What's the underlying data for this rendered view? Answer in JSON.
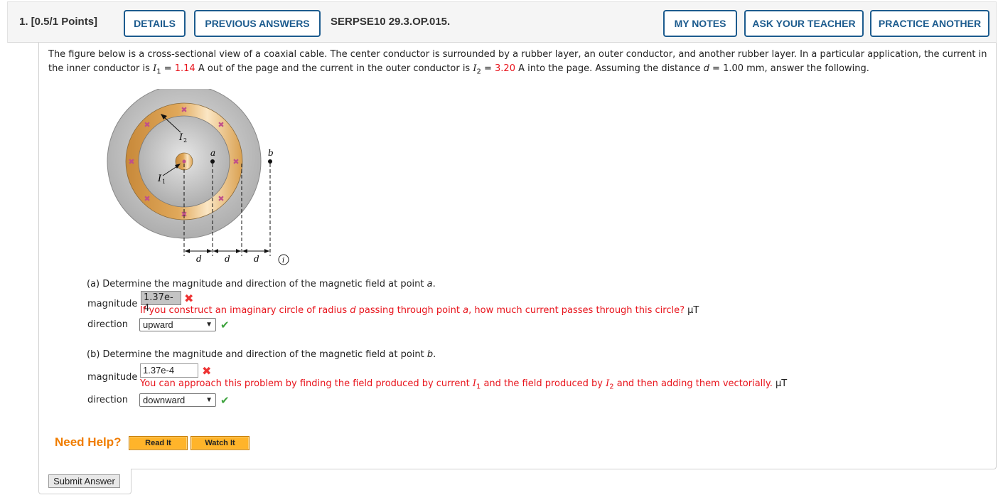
{
  "header": {
    "question_label": "1.  [0.5/1 Points]",
    "details_button": "DETAILS",
    "previous_answers_button": "PREVIOUS ANSWERS",
    "question_id": "SERPSE10 29.3.OP.015.",
    "my_notes_button": "MY NOTES",
    "ask_teacher_button": "ASK YOUR TEACHER",
    "practice_another_button": "PRACTICE ANOTHER"
  },
  "prompt": {
    "part1": "The figure below is a cross-sectional view of a coaxial cable. The center conductor is surrounded by a rubber layer, an outer conductor, and another rubber layer. In a particular application, the current in the inner conductor is ",
    "i1_symbol": "I",
    "i1_sub": "1",
    "eq": " = ",
    "i1_value": "1.14",
    "part2": " A out of the page and the current in the outer conductor is ",
    "i2_symbol": "I",
    "i2_sub": "2",
    "i2_value": "3.20",
    "part3": " A into the page. Assuming the distance ",
    "d_symbol": "d",
    "part4": " = 1.00 mm, answer the following."
  },
  "figure": {
    "label_i1": "I",
    "label_i1_sub": "1",
    "label_i2": "I",
    "label_i2_sub": "2",
    "label_a": "a",
    "label_b": "b",
    "label_d": "d",
    "info_icon": "i",
    "colors": {
      "rubber": "#bdbdbd",
      "conductor": "#d9a050",
      "current_mark": "#c0508a"
    }
  },
  "part_a": {
    "question": "(a) Determine the magnitude and direction of the magnetic field at point ",
    "point": "a",
    "period": ".",
    "magnitude_label": "magnitude",
    "magnitude_value": "1.37e-4",
    "magnitude_status": "incorrect",
    "hint_1": "If you construct an imaginary circle of radius ",
    "hint_d": "d",
    "hint_2": " passing through point ",
    "hint_a": "a",
    "hint_3": ", how much current passes through this circle?",
    "unit": " μT",
    "direction_label": "direction",
    "direction_value": "upward",
    "direction_status": "correct"
  },
  "part_b": {
    "question": "(b) Determine the magnitude and direction of the magnetic field at point ",
    "point": "b",
    "period": ".",
    "magnitude_label": "magnitude",
    "magnitude_value": "1.37e-4",
    "magnitude_status": "incorrect",
    "hint_1": "You can approach this problem by finding the field produced by current ",
    "hint_i1": "I",
    "hint_i1_sub": "1",
    "hint_2": " and the field produced by ",
    "hint_i2": "I",
    "hint_i2_sub": "2",
    "hint_3": " and then adding them vectorially.",
    "unit": " μT",
    "direction_label": "direction",
    "direction_value": "downward",
    "direction_status": "correct"
  },
  "help": {
    "label": "Need Help?",
    "read_it": "Read It",
    "watch_it": "Watch It"
  },
  "submit_label": "Submit Answer",
  "icons": {
    "incorrect": "✖",
    "correct": "✔",
    "chevron": "⌄"
  }
}
